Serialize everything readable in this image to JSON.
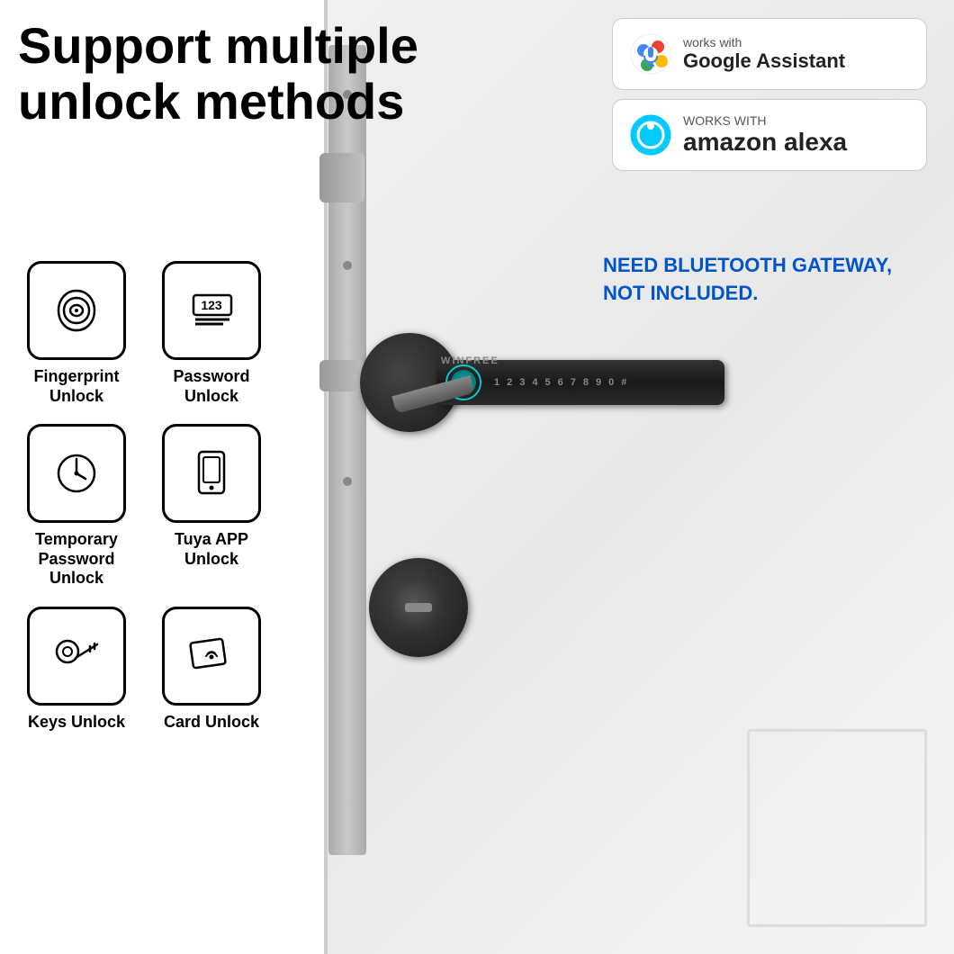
{
  "title": "Support multiple unlock methods",
  "badges": [
    {
      "id": "google-assistant",
      "small_text": "works with",
      "large_text": "Google Assistant",
      "icon_type": "google"
    },
    {
      "id": "amazon-alexa",
      "small_text": "WORKS WITH",
      "large_text": "amazon alexa",
      "icon_type": "alexa"
    }
  ],
  "bluetooth_notice": "NEED BLUETOOTH GATEWAY, NOT INCLUDED.",
  "unlock_methods": [
    {
      "id": "fingerprint",
      "label": "Fingerprint\nUnlock",
      "icon": "fingerprint"
    },
    {
      "id": "password",
      "label": "Password\nUnlock",
      "icon": "password"
    },
    {
      "id": "temporary",
      "label": "Temporary\nPassword\nUnlock",
      "icon": "temporary"
    },
    {
      "id": "tuya",
      "label": "Tuya APP\nUnlock",
      "icon": "app"
    },
    {
      "id": "keys",
      "label": "Keys Unlock",
      "icon": "key"
    },
    {
      "id": "card",
      "label": "Card  Unlock",
      "icon": "card"
    }
  ],
  "brand": "WINFREE",
  "keypad_numbers": [
    "1",
    "2",
    "3",
    "4",
    "5",
    "6",
    "7",
    "8",
    "9",
    "0",
    "#"
  ]
}
